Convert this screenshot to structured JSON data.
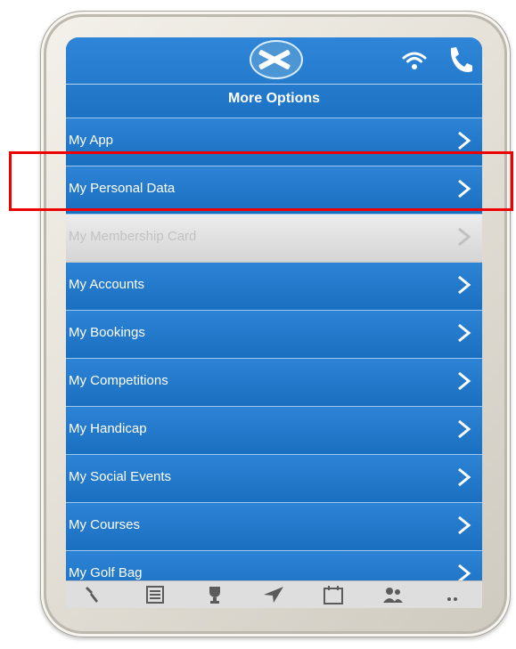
{
  "header": {
    "title": "More Options",
    "logo_icon": "saltire-flag-icon",
    "status_icons": [
      "wifi-icon",
      "phone-icon"
    ]
  },
  "menu": {
    "items": [
      {
        "label": "My App",
        "enabled": true
      },
      {
        "label": "My Personal Data",
        "enabled": true,
        "highlighted": true
      },
      {
        "label": "My Membership Card",
        "enabled": false
      },
      {
        "label": "My Accounts",
        "enabled": true
      },
      {
        "label": "My Bookings",
        "enabled": true
      },
      {
        "label": "My Competitions",
        "enabled": true
      },
      {
        "label": "My Handicap",
        "enabled": true
      },
      {
        "label": "My Social Events",
        "enabled": true
      },
      {
        "label": "My Courses",
        "enabled": true
      },
      {
        "label": "My Golf Bag",
        "enabled": true
      }
    ],
    "arrow_glyph": ">"
  },
  "tabbar": {
    "icons": [
      "golf-icon",
      "news-icon",
      "trophy-icon",
      "navigate-icon",
      "calendar-icon",
      "members-icon",
      "more-icon"
    ]
  },
  "colors": {
    "accent_blue": "#1b72c4",
    "highlight_red": "#ec0000",
    "disabled_gray": "#dcdcdc"
  }
}
